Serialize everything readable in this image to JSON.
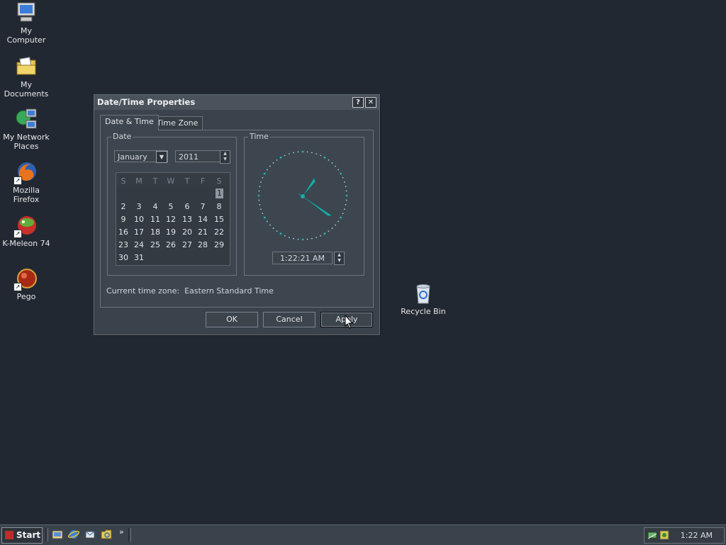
{
  "desktop": {
    "icons": [
      {
        "label": "My Computer"
      },
      {
        "label": "My Documents"
      },
      {
        "label": "My Network Places"
      },
      {
        "label": "Mozilla Firefox"
      },
      {
        "label": "K-Meleon 74"
      },
      {
        "label": "Pego"
      },
      {
        "label": "Recycle Bin"
      }
    ]
  },
  "dialog": {
    "title": "Date/Time Properties",
    "help_button": "?",
    "close_button": "✕",
    "tabs": [
      {
        "label": "Date & Time",
        "active": true
      },
      {
        "label": "Time Zone",
        "active": false
      }
    ],
    "date_group": {
      "label": "Date",
      "month": "January",
      "year": "2011",
      "weekdays": [
        "S",
        "M",
        "T",
        "W",
        "T",
        "F",
        "S"
      ],
      "weeks": [
        [
          "",
          "",
          "",
          "",
          "",
          "",
          "1"
        ],
        [
          "2",
          "3",
          "4",
          "5",
          "6",
          "7",
          "8"
        ],
        [
          "9",
          "10",
          "11",
          "12",
          "13",
          "14",
          "15"
        ],
        [
          "16",
          "17",
          "18",
          "19",
          "20",
          "21",
          "22"
        ],
        [
          "23",
          "24",
          "25",
          "26",
          "27",
          "28",
          "29"
        ],
        [
          "30",
          "31",
          "",
          "",
          "",
          "",
          ""
        ]
      ],
      "selected_day": "1"
    },
    "time_group": {
      "label": "Time",
      "time_value": "1:22:21 AM"
    },
    "timezone_text": "Current time zone:  Eastern Standard Time",
    "buttons": {
      "ok": "OK",
      "cancel": "Cancel",
      "apply": "Apply"
    }
  },
  "taskbar": {
    "start_label": "Start",
    "chevron": "»",
    "clock": "1:22 AM"
  }
}
